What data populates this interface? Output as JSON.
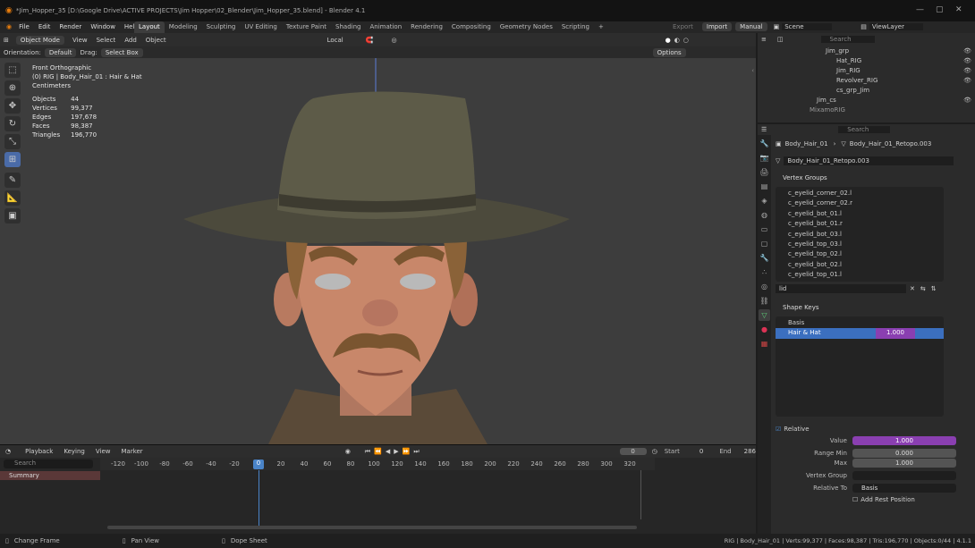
{
  "window": {
    "title": "*Jim_Hopper_35 [D:\\Google Drive\\ACTIVE PROJECTS\\Jim Hopper\\02_Blender\\Jim_Hopper_35.blend] - Blender 4.1"
  },
  "menu": [
    "File",
    "Edit",
    "Render",
    "Window",
    "Help"
  ],
  "workspaces": [
    "Layout",
    "Modeling",
    "Sculpting",
    "UV Editing",
    "Texture Paint",
    "Shading",
    "Animation",
    "Rendering",
    "Compositing",
    "Geometry Nodes",
    "Scripting"
  ],
  "topright": {
    "export": "Export",
    "import": "Import",
    "manual": "Manual",
    "scene": "Scene",
    "viewlayer": "ViewLayer"
  },
  "viewport_header": {
    "mode": "Object Mode",
    "view": "View",
    "select": "Select",
    "add": "Add",
    "object": "Object",
    "transform": "Local"
  },
  "viewport_header2": {
    "orientation_label": "Orientation:",
    "orientation": "Default",
    "drag_label": "Drag:",
    "drag": "Select Box",
    "options": "Options"
  },
  "viewport_info": {
    "view": "Front Orthographic",
    "object": "(0) RIG | Body_Hair_01 : Hair & Hat",
    "units": "Centimeters",
    "stats": [
      {
        "k": "Objects",
        "v": "44"
      },
      {
        "k": "Vertices",
        "v": "99,377"
      },
      {
        "k": "Edges",
        "v": "197,678"
      },
      {
        "k": "Faces",
        "v": "98,387"
      },
      {
        "k": "Triangles",
        "v": "196,770"
      }
    ]
  },
  "timeline_header": {
    "playback": "Playback",
    "keying": "Keying",
    "view": "View",
    "marker": "Marker",
    "frame": "0",
    "start_label": "Start",
    "start": "0",
    "end_label": "End",
    "end": "286"
  },
  "timeline": {
    "search_placeholder": "Search",
    "summary": "Summary",
    "playhead": "0",
    "ticks": [
      "-120",
      "-100",
      "-80",
      "-60",
      "-40",
      "-20",
      "20",
      "40",
      "60",
      "80",
      "100",
      "120",
      "140",
      "160",
      "180",
      "200",
      "220",
      "240",
      "260",
      "280",
      "300",
      "320"
    ]
  },
  "statusbar": {
    "left": "Change Frame",
    "mid": "Pan View",
    "mid2": "Dope Sheet",
    "right": "RIG | Body_Hair_01 | Verts:99,377 | Faces:98,387 | Tris:196,770 | Objects:0/44 | 4.1.1"
  },
  "outliner": {
    "search_placeholder": "Search",
    "rows": [
      {
        "name": "Jim_grp",
        "indent": 0
      },
      {
        "name": "Hat_RIG",
        "indent": 1
      },
      {
        "name": "Jim_RIG",
        "indent": 1
      },
      {
        "name": "Revolver_RIG",
        "indent": 1
      },
      {
        "name": "cs_grp_Jim",
        "indent": 1
      },
      {
        "name": "Jim_cs",
        "indent": 0
      },
      {
        "name": "MixamoRIG",
        "indent": 0
      }
    ]
  },
  "props": {
    "breadcrumb_obj": "Body_Hair_01",
    "breadcrumb_mesh": "Body_Hair_01_Retopo.003",
    "mesh_name": "Body_Hair_01_Retopo.003",
    "search_placeholder": "Search",
    "vertex_groups_title": "Vertex Groups",
    "vertex_groups": [
      "c_eyelid_corner_02.l",
      "c_eyelid_corner_02.r",
      "c_eyelid_bot_01.l",
      "c_eyelid_bot_01.r",
      "c_eyelid_bot_03.l",
      "c_eyelid_top_03.l",
      "c_eyelid_top_02.l",
      "c_eyelid_bot_02.l",
      "c_eyelid_top_01.l"
    ],
    "vg_filter": "lid",
    "shape_keys_title": "Shape Keys",
    "shape_keys": [
      {
        "name": "Basis",
        "value": ""
      },
      {
        "name": "Hair & Hat",
        "value": "1.000"
      }
    ],
    "relative_label": "Relative",
    "value_label": "Value",
    "value": "1.000",
    "range_min_label": "Range Min",
    "range_min": "0.000",
    "max_label": "Max",
    "max": "1.000",
    "vgroup_label": "Vertex Group",
    "relative_to_label": "Relative To",
    "relative_to": "Basis",
    "add_rest": "Add Rest Position"
  }
}
